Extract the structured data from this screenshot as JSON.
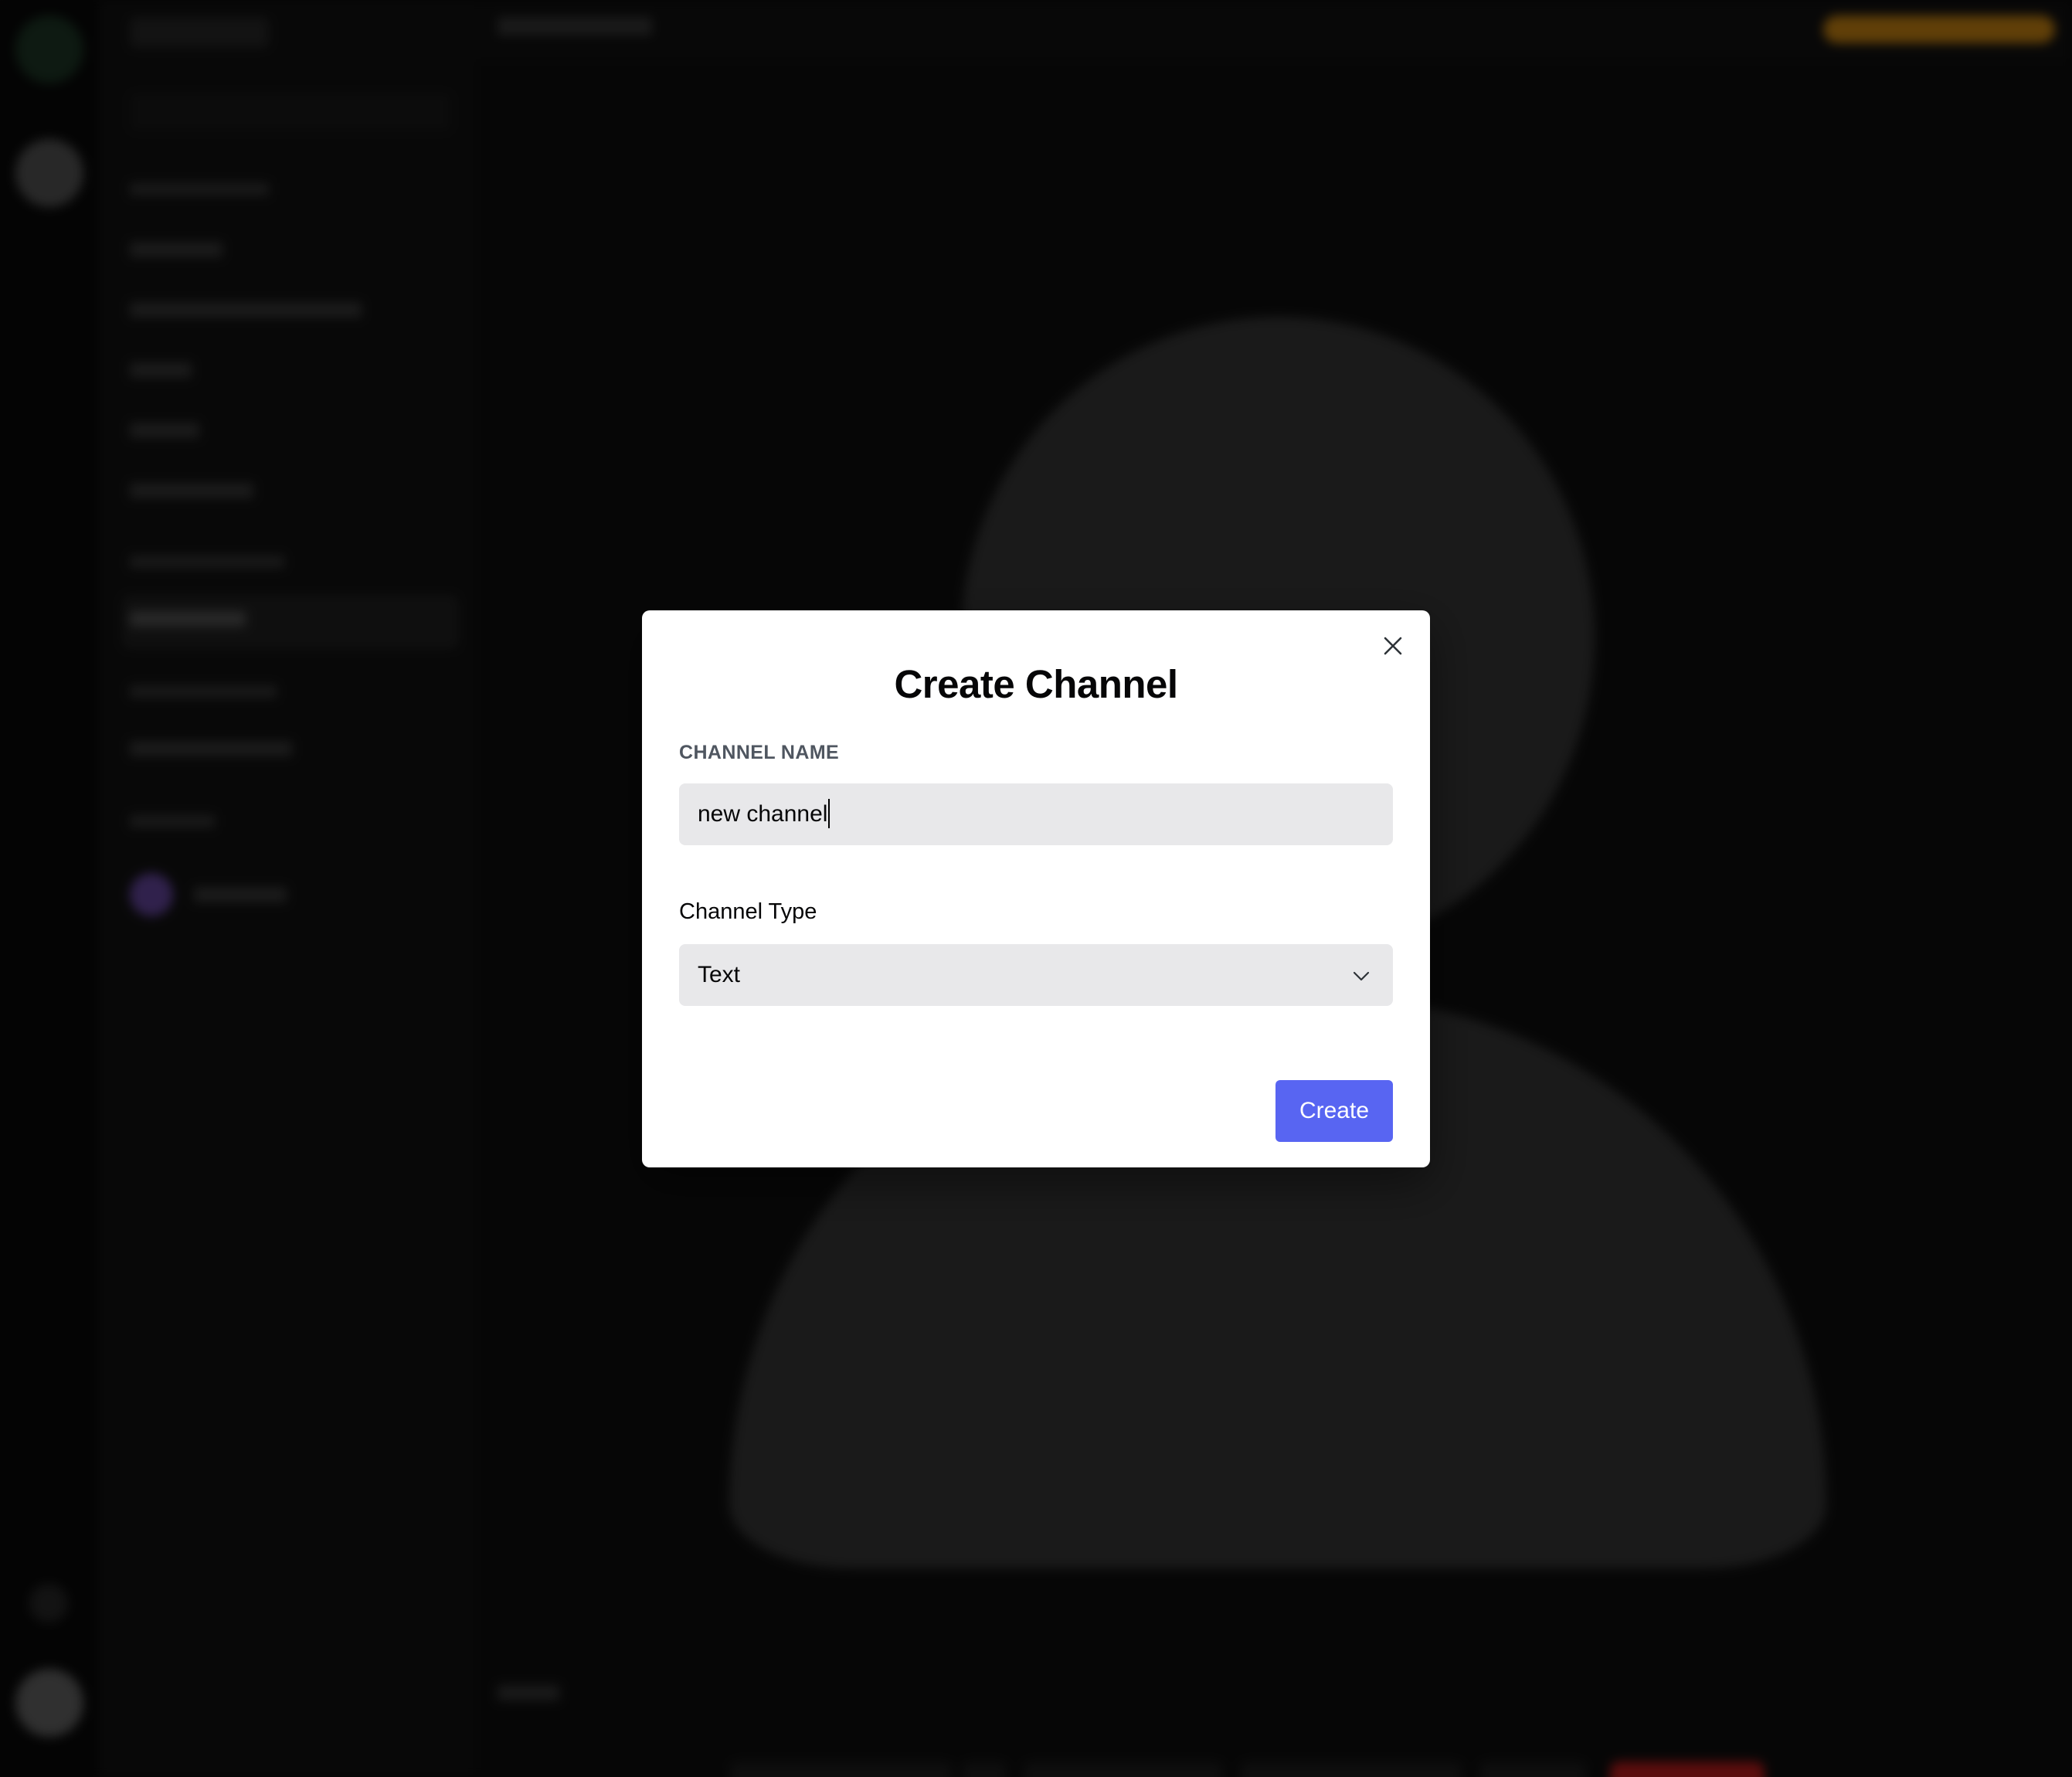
{
  "modal": {
    "title": "Create Channel",
    "name_label": "CHANNEL NAME",
    "name_value": "new channel",
    "type_label": "Channel Type",
    "type_selected": "Text",
    "create_label": "Create",
    "close_icon": "close-icon",
    "chevron_icon": "chevron-down-icon"
  },
  "colors": {
    "accent": "#5865f2",
    "overlay": "rgba(0,0,0,0.55)",
    "leave": "#c81e1e",
    "badge": "#d58c12"
  }
}
